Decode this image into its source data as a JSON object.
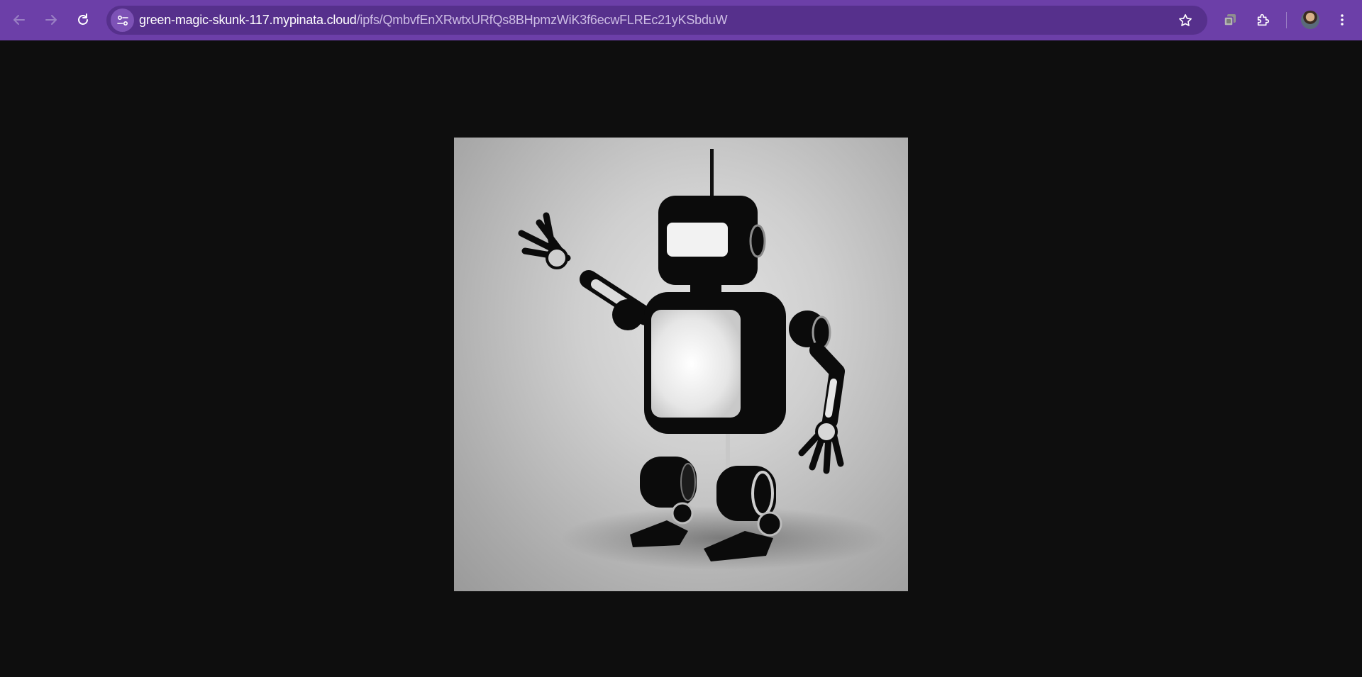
{
  "browser": {
    "url_host": "green-magic-skunk-117.mypinata.cloud",
    "url_path": "/ipfs/QmbvfEnXRwtxURfQs8BHpmzWiK3f6ecwFLREc21yKSbduW"
  },
  "toolbar_icons": [
    "back-arrow-icon",
    "forward-arrow-icon",
    "reload-icon",
    "site-settings-icon",
    "bookmark-star-icon",
    "cast-icon",
    "extensions-puzzle-icon",
    "profile-avatar",
    "more-menu-icon"
  ],
  "colors": {
    "toolbar": "#6c3fa8",
    "omnibox": "#56308c",
    "page_background": "#0e0e0e"
  },
  "content": {
    "image_subject": "robot-image"
  }
}
